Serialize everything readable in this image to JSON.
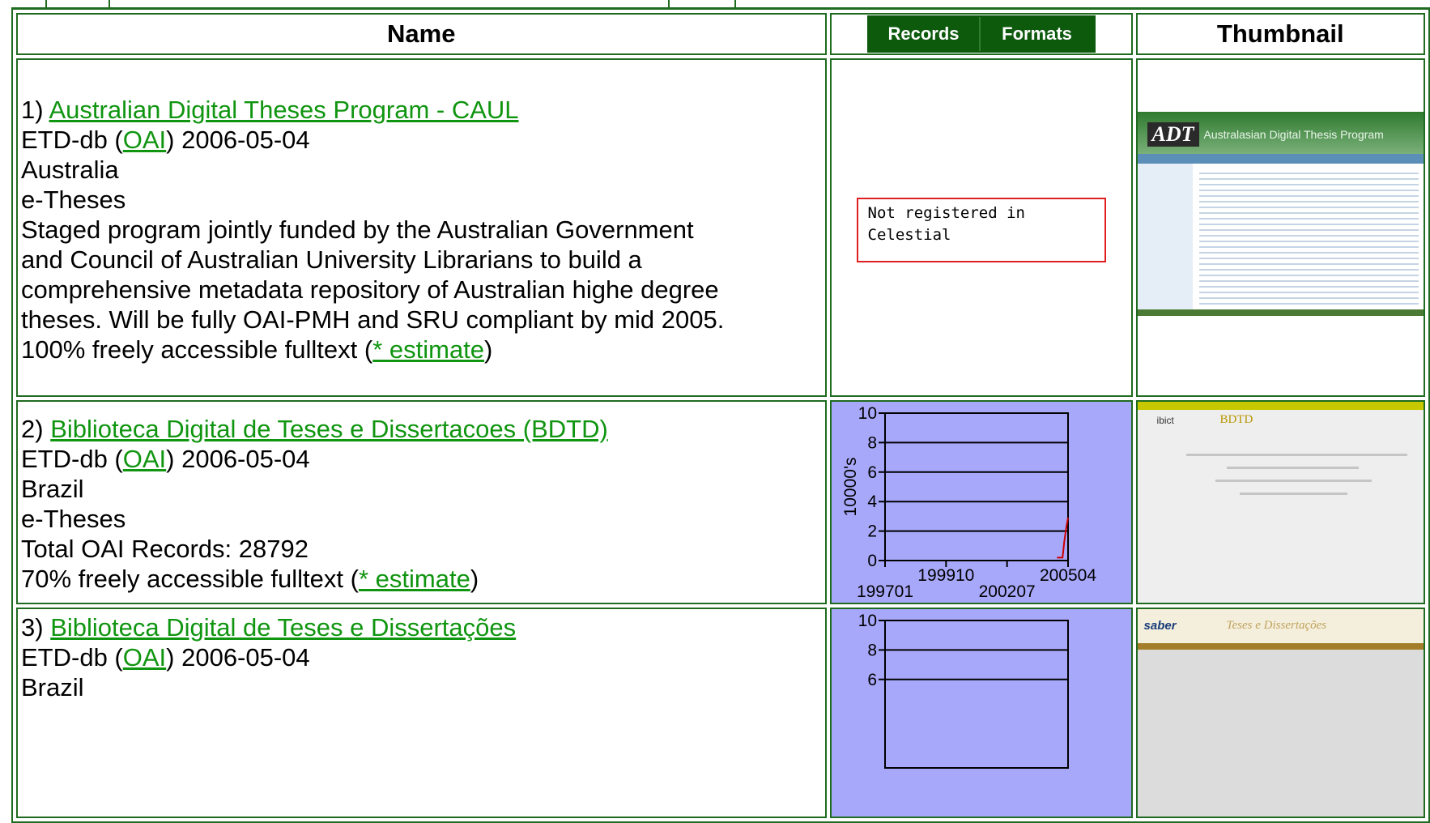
{
  "header": {
    "name": "Name",
    "records": "Records",
    "formats": "Formats",
    "thumbnail": "Thumbnail"
  },
  "rows": [
    {
      "number": "1)",
      "title": "Australian Digital Theses Program - CAUL",
      "software": "ETD-db (",
      "oai_link": "OAI",
      "date": ") 2006-05-04",
      "country": "Australia",
      "type": "e-Theses",
      "description": "Staged program jointly funded by the Australian Government and Council of Australian University Librarians to build a comprehensive metadata repository of Australian highe degree theses. Will be fully OAI-PMH and SRU compliant by mid 2005.",
      "fulltext_prefix": "100% freely accessible fulltext (",
      "estimate_link": "* estimate",
      "fulltext_suffix": ")",
      "graph_notice": "Not registered in Celestial",
      "thumbnail_title": "Australasian Digital Thesis Program",
      "thumbnail_logo": "ADT"
    },
    {
      "number": "2)",
      "title": "Biblioteca Digital de Teses e Dissertacoes (BDTD)",
      "software": "ETD-db (",
      "oai_link": "OAI",
      "date": ") 2006-05-04",
      "country": "Brazil",
      "type": "e-Theses",
      "records_text": "Total OAI Records: 28792",
      "fulltext_prefix": "70% freely accessible fulltext (",
      "estimate_link": "* estimate",
      "fulltext_suffix": ")",
      "thumbnail_logo": "BDTD",
      "thumbnail_org": "ibict"
    },
    {
      "number": "3)",
      "title": "Biblioteca Digital de Teses e Dissertações",
      "software": "ETD-db (",
      "oai_link": "OAI",
      "date": ") 2006-05-04",
      "country": "Brazil",
      "thumbnail_logo": "saber",
      "thumbnail_title": "Teses e Dissertações"
    }
  ],
  "chart_data": [
    {
      "type": "line",
      "ylabel": "10000's",
      "ylim": [
        0,
        10
      ],
      "yticks": [
        0,
        2,
        4,
        6,
        8,
        10
      ],
      "xticks_upper": [
        "199910",
        "200504"
      ],
      "xticks_lower": [
        "199701",
        "200207"
      ],
      "series": [
        {
          "color": "#cc0000",
          "x": [
            "200410",
            "200412",
            "200501",
            "200502",
            "200503",
            "200504"
          ],
          "values": [
            0.2,
            0.2,
            0.2,
            1.3,
            2.2,
            2.9
          ]
        }
      ]
    },
    {
      "type": "line",
      "ylabel": "",
      "ylim": [
        0,
        10
      ],
      "yticks": [
        6,
        8,
        10
      ],
      "series": []
    }
  ],
  "colors": {
    "border": "#1f6b1f",
    "link": "#109510",
    "header_button_bg": "#0d5a0d",
    "chart_bg": "#a8a8fb",
    "series_line": "#cc0000",
    "notice_border": "#e02020"
  }
}
